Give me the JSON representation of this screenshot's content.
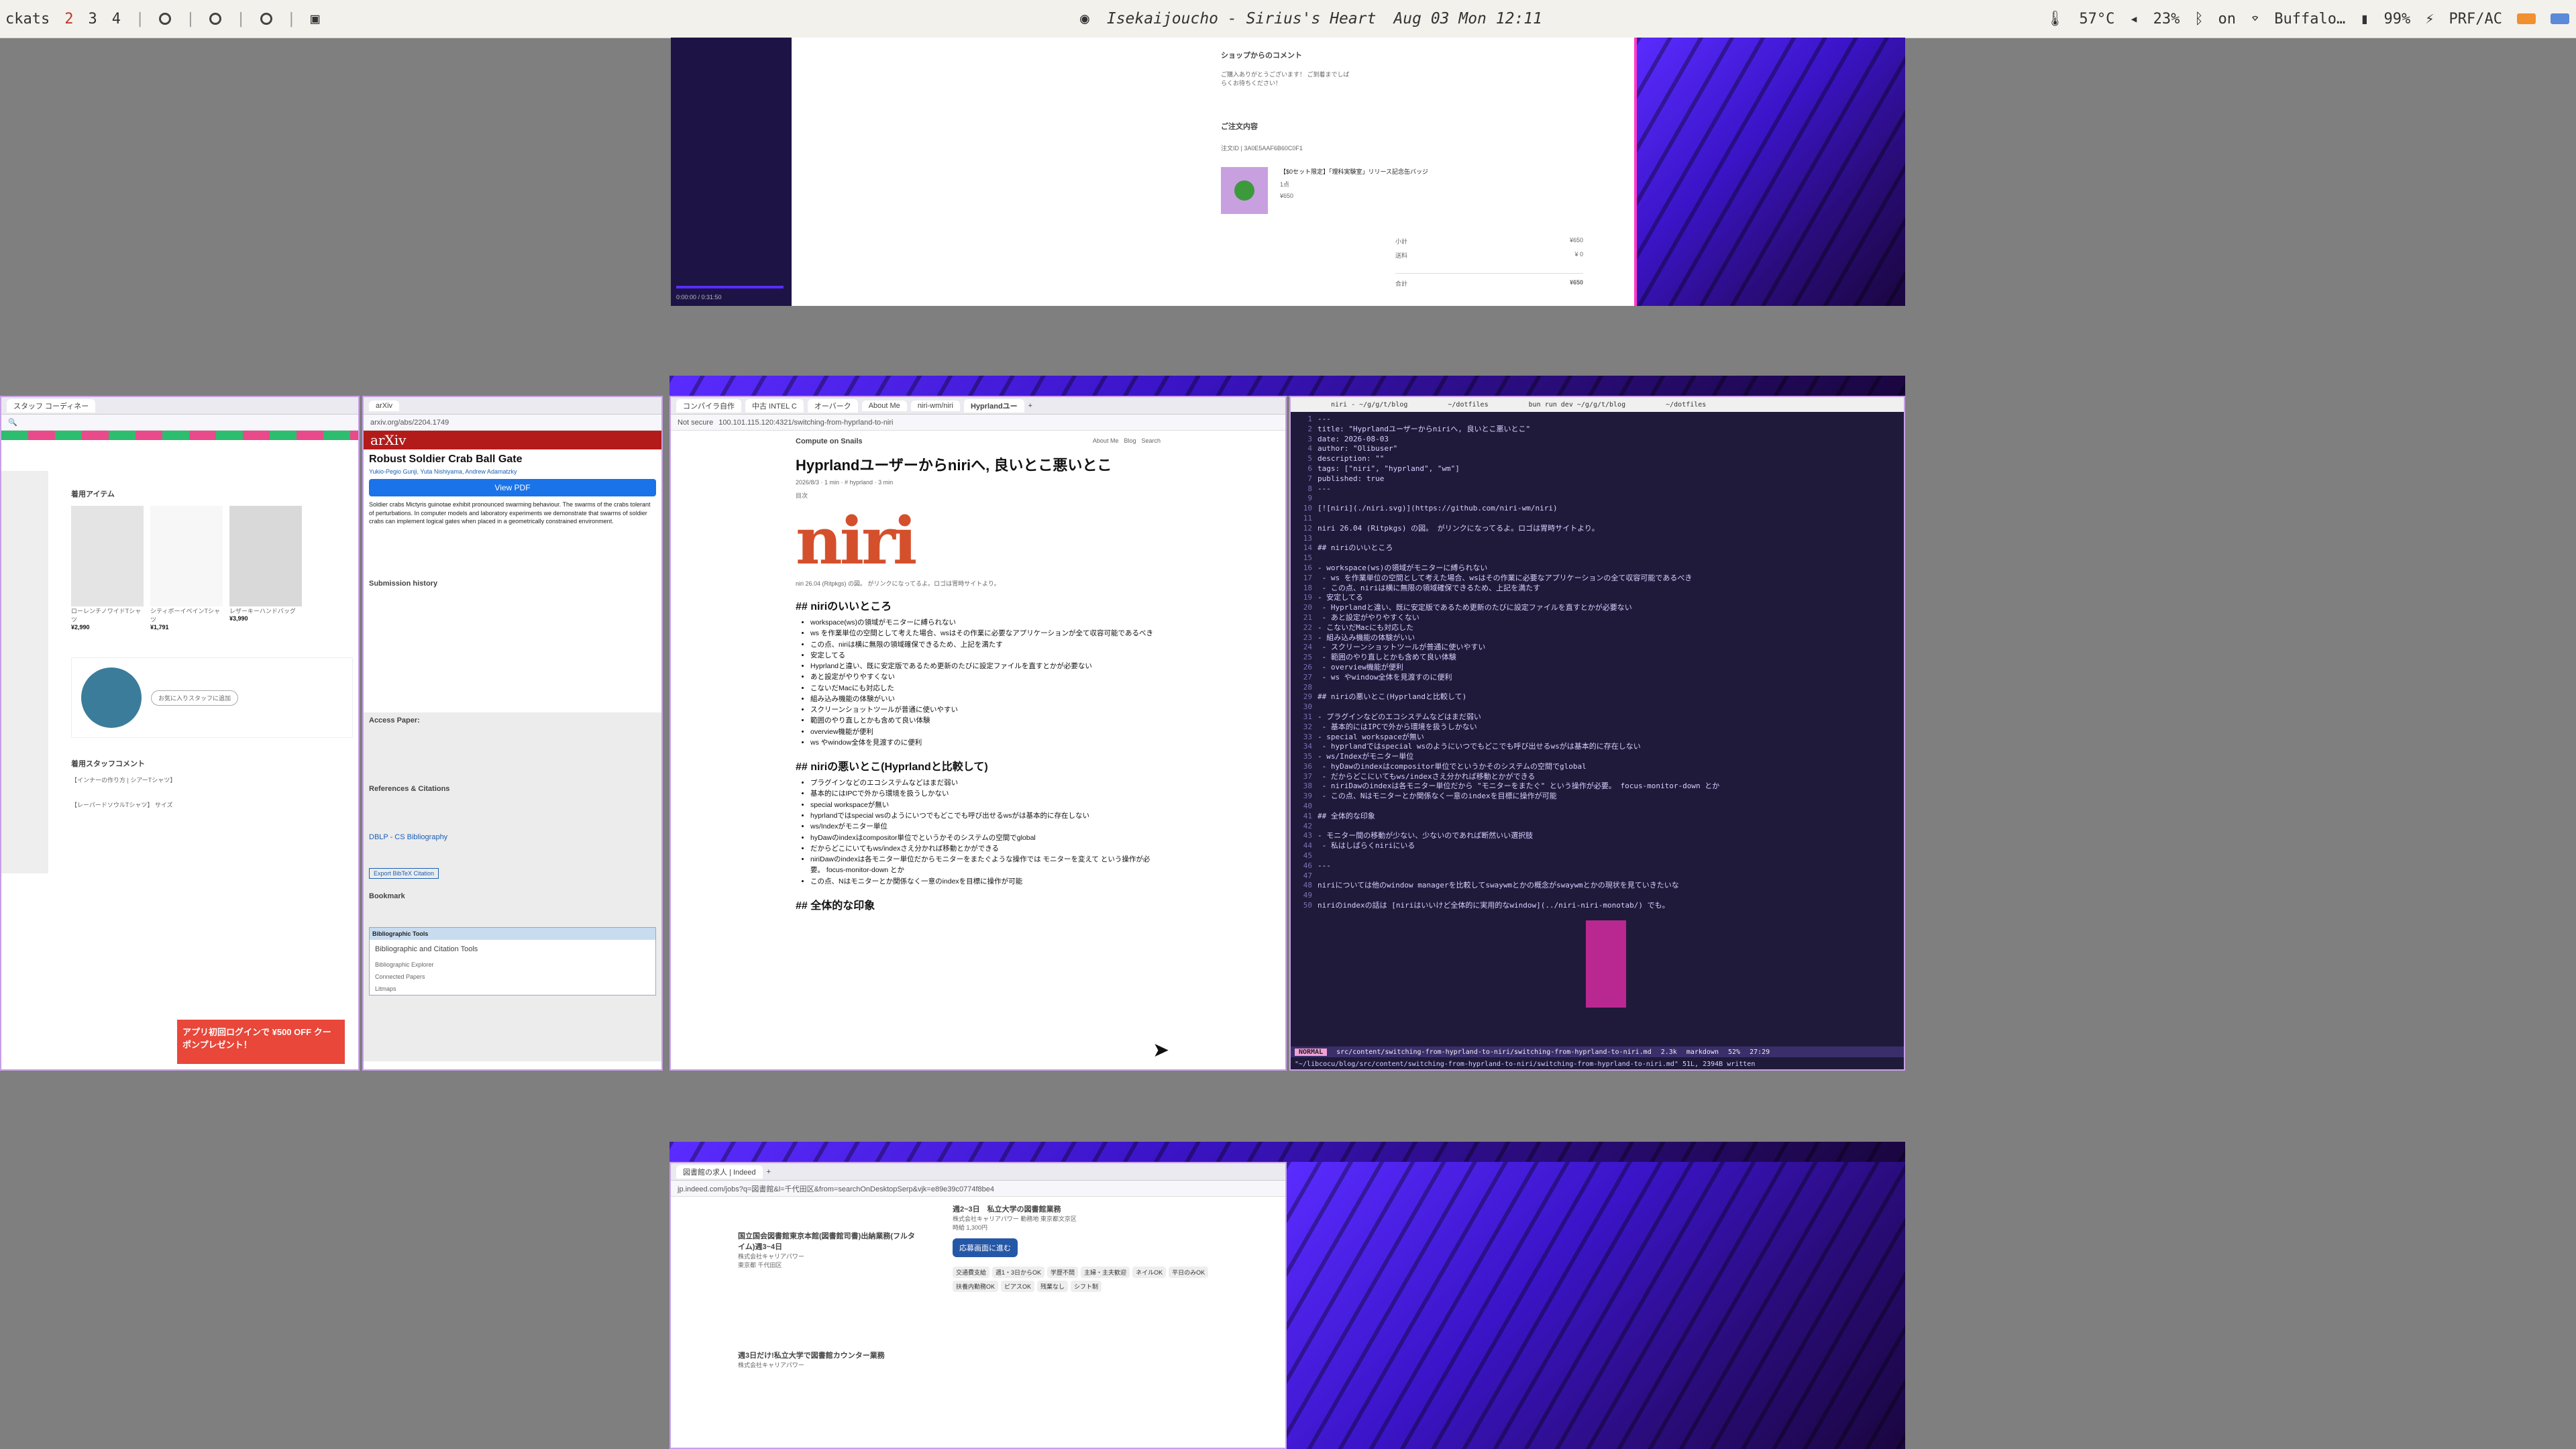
{
  "topbar": {
    "workspace_fragment": "ckats",
    "workspaces": [
      "2",
      "3",
      "4"
    ],
    "now_playing": "Isekaijoucho - Sirius's Heart",
    "datetime": "Aug 03 Mon 12:11",
    "temp": "57°C",
    "volume": "23%",
    "bt": "on",
    "wifi": "Buffalo…",
    "battery": "99%",
    "power_profile": "PRF/AC"
  },
  "shop_window": {
    "comment_heading": "ショップからのコメント",
    "comment_text": "ご購入ありがとうございます！ ご到着までしばらくお待ちください！",
    "order_heading": "ご注文内容",
    "order_no": "注文ID | 3A0E5AAF6B60C0F1",
    "item_name": "【$0セット限定】「理科実験室」リリース記念缶バッジ",
    "item_qty": "1点",
    "item_price": "¥650",
    "subtotal_label": "小計",
    "subtotal": "¥650",
    "shipping_label": "送料",
    "shipping": "¥ 0",
    "total_label": "合計",
    "total": "¥650",
    "video_time": "0:00:00 / 0:31:50"
  },
  "zozo_window": {
    "title": "スタッフ コーディネー",
    "section_items": "着用アイテム",
    "items": [
      {
        "name": "ローレンチノワイドTシャツ",
        "price": "¥2,990"
      },
      {
        "name": "シティボーイペインTシャツ",
        "price": "¥1,791"
      },
      {
        "name": "レザーキーハンドバッグ",
        "price": "¥3,990"
      }
    ],
    "staff_comment_heading": "着用スタッフコメント",
    "comment": "【インナーの作り方 | シアーTシャツ】",
    "comment2": "【レーパードソウルTシャツ】 サイズ",
    "coupon": "アプリ初回ログインで ¥500 OFF クーポンプレゼント！",
    "follow": "お気に入りスタッフに追加"
  },
  "arxiv_window": {
    "url": "arxiv.org/abs/2204.1749",
    "logo": "arXiv",
    "paper_title": "Robust Soldier Crab Ball Gate",
    "authors": "Yukio-Pegio Gunji, Yuta Nishiyama, Andrew Adamatzky",
    "abstract": "Soldier crabs Mictyris guinotae exhibit pronounced swarming behaviour. The swarms of the crabs tolerant of perturbations. In computer models and laboratory experiments we demonstrate that swarms of soldier crabs can implement logical gates when placed in a geometrically constrained environment.",
    "view_pdf": "View PDF",
    "submission_history": "Submission history",
    "access_paper": "Access Paper:",
    "refs": "References & Citations",
    "dblp": "DBLP - CS Bibliography",
    "export": "Export BibTeX Citation",
    "bookmark": "Bookmark",
    "bib_tools": "Bibliographic Tools",
    "bib_heading": "Bibliographic and Citation Tools",
    "bib_items": [
      "Bibliographic Explorer",
      "Connected Papers",
      "Litmaps"
    ]
  },
  "blog_window": {
    "tabs": [
      "コンパイラ自作",
      "中古 INTEL C",
      "オーバーク",
      "About Me",
      "niri-wm/niri",
      "Hyprlandユー"
    ],
    "url": "100.101.115.120:4321/switching-from-hyprland-to-niri",
    "not_secure": "Not secure",
    "site_name": "Compute on Snails",
    "nav": [
      "About Me",
      "Blog",
      "Search"
    ],
    "title": "Hyprlandユーザーからniriへ, 良いとこ悪いとこ",
    "meta": "2026/8/3 · 1 min · # hyprland · 3 min",
    "toc": "目次",
    "logo_text": "niri",
    "caption": "niri 26.04 (Ritpkgs) の図。 がリンクになってるよ。ロゴは胃時サイトより。",
    "h_good": "## niriのいいところ",
    "good": [
      "workspace(ws)の領域がモニターに縛られない",
      "ws を作業単位の空間として考えた場合、wsはその作業に必要なアプリケーションが全て収容可能であるべき",
      "この点、niriは横に無限の領域確保できるため、上記を満たす",
      "安定してる",
      "Hyprlandと違い、既に安定版であるため更新のたびに設定ファイルを直すとかが必要ない",
      "あと設定がやりやすくない",
      "こないだMacにも対応した",
      "組み込み機能の体験がいい",
      "スクリーンショットツールが普通に使いやすい",
      "範囲のやり直しとかも含めて良い体験",
      "overview機能が便利",
      "ws やwindow全体を見渡すのに便利"
    ],
    "h_bad": "## niriの悪いとこ(Hyprlandと比較して)",
    "bad": [
      "プラグインなどのエコシステムなどはまだ弱い",
      "基本的にはIPCで外から環境を扱うしかない",
      "special workspaceが無い",
      "hyprlandではspecial wsのようにいつでもどこでも呼び出せるwsがは基本的に存在しない",
      "ws/Indexがモニター単位",
      "hyDawのindexはcompositor単位でというかそのシステムの空間でglobal",
      "だからどこにいてもws/indexさえ分かれば移動とかができる",
      "niriDawのindexは各モニター単位だからモニターをまたぐような操作では モニターを変えて という操作が必要。 focus-monitor-down とか",
      "この点、Nはモニターとか関係なく一意のindexを目標に操作が可能"
    ],
    "h_overall": "## 全体的な印象"
  },
  "terminal_window": {
    "tabs": [
      "niri - ~/g/g/t/blog",
      "~/dotfiles",
      "bun run dev ~/g/g/t/blog",
      "~/dotfiles"
    ],
    "lines": [
      "---",
      "title: \"Hyprlandユーザーからniriへ, 良いとこ悪いとこ\"",
      "date: 2026-08-03",
      "author: \"Olibuser\"",
      "description: \"\"",
      "tags: [\"niri\", \"hyprland\", \"wm\"]",
      "published: true",
      "---",
      "",
      "[![niri](./niri.svg)](https://github.com/niri-wm/niri)",
      "",
      "niri 26.04 (Ritpkgs) の図。 がリンクになってるよ。ロゴは胃時サイトより。",
      "",
      "## niriのいいところ",
      "",
      "- workspace(ws)の領域がモニターに縛られない",
      "  - ws を作業単位の空間として考えた場合、wsはその作業に必要なアプリケーションの全て収容可能であるべき",
      "    - この点、niriは横に無限の領域確保できるため、上記を満たす",
      "- 安定してる",
      "  - Hyprlandと違い、既に安定版であるため更新のたびに設定ファイルを直すとかが必要ない",
      "    - あと設定がやりやすくない",
      "- こないだMacにも対応した",
      "- 組み込み機能の体験がいい",
      "  - スクリーンショットツールが普通に使いやすい",
      "    - 範囲のやり直しとかも含めて良い体験",
      "  - overview機能が便利",
      "    - ws やwindow全体を見渡すのに便利",
      "",
      "## niriの悪いとこ(Hyprlandと比較して)",
      "",
      "- プラグインなどのエコシステムなどはまだ弱い",
      "  - 基本的にはIPCで外から環境を扱うしかない",
      "- special workspaceが無い",
      "  - hyprlandではspecial wsのようにいつでもどこでも呼び出せるwsがは基本的に存在しない",
      "- ws/Indexがモニター単位",
      "  - hyDawのindexはcompositor単位でというかそのシステムの空間でglobal",
      "    - だからどこにいてもws/indexさえ分かれば移動とかができる",
      "  - niriDawのindexは各モニター単位だから \"モニターをまたぐ\" という操作が必要。 focus-monitor-down とか",
      "    - この点、Nはモニターとか関係なく一意のindexを目標に操作が可能",
      "",
      "## 全体的な印象",
      "",
      "- モニター間の移動が少ない、少ないのであれば断然いい選択肢",
      "  - 私はしばらくniriにいる",
      "",
      "---",
      "",
      "niriについては他のwindow managerを比較してswaywmとかの概念がswaywmとかの現状を見ていきたいな",
      "",
      "niriのindexの話は [niriはいいけど全体的に実用的なwindow](../niri-niri-monotab/) でも。"
    ],
    "status_mode": "NORMAL",
    "status_file": "src/content/switching-from-hyprland-to-niri/switching-from-hyprland-to-niri.md",
    "status_size": "2.3k",
    "status_ft": "markdown",
    "status_pct": "52%",
    "status_pos": "27:29",
    "cmdline": "\"~/libcocu/blog/src/content/switching-from-hyprland-to-niri/switching-from-hyprland-to-niri.md\" 51L, 2394B written"
  },
  "jobs_window": {
    "tab": "図書館の求人 | Indeed",
    "url": "jp.indeed.com/jobs?q=図書館&l=千代田区&from=searchOnDesktopSerp&vjk=e89e39c0774f8be4",
    "job1_title": "国立国会図書館東京本館(図書館司書)出納業務(フルタイム)週3~4日",
    "job1_company": "株式会社キャリアパワー",
    "job1_loc": "東京都 千代田区",
    "job2_title": "週3日だけ!私立大学で図書館カウンター業務",
    "job2_company": "株式会社キャリアパワー",
    "detail_title": "週2~3日　私立大学の図書館業務",
    "detail_company": "株式会社キャリアパワー 勤務地 東京都文京区",
    "detail_wage": "時給 1,300円",
    "apply": "応募画面に進む",
    "tags": [
      "交通費支給",
      "週1・3日からOK",
      "学歴不問",
      "主婦・主夫歓迎",
      "ネイルOK",
      "平日のみOK",
      "扶養内勤務OK",
      "ピアスOK",
      "残業なし",
      "シフト制"
    ]
  }
}
